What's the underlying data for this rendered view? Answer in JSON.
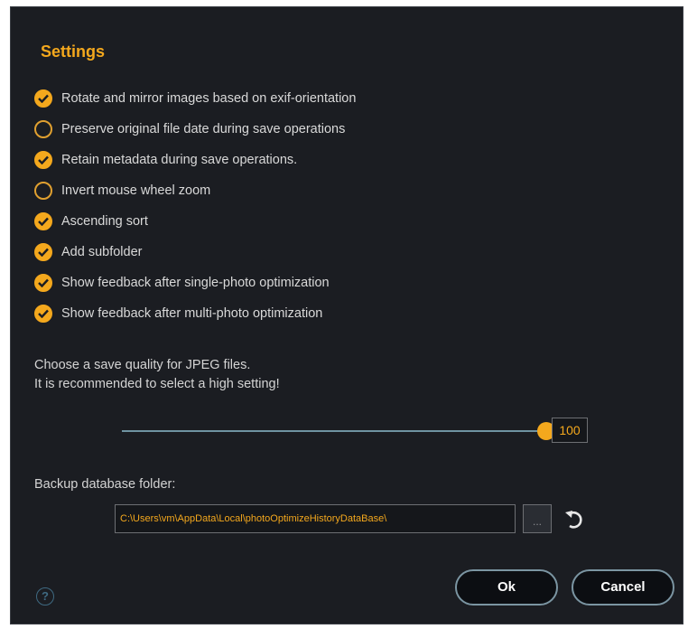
{
  "dialog": {
    "title": "Settings"
  },
  "options": [
    {
      "label": "Rotate and mirror images based on exif-orientation",
      "checked": true
    },
    {
      "label": "Preserve original file date during save operations",
      "checked": false
    },
    {
      "label": "Retain metadata during save operations.",
      "checked": true
    },
    {
      "label": "Invert mouse wheel zoom",
      "checked": false
    },
    {
      "label": "Ascending sort",
      "checked": true
    },
    {
      "label": "Add subfolder",
      "checked": true
    },
    {
      "label": "Show feedback after single-photo optimization",
      "checked": true
    },
    {
      "label": "Show feedback after multi-photo optimization",
      "checked": true
    }
  ],
  "quality": {
    "line1": "Choose a save quality for JPEG files.",
    "line2": "It is recommended to select a high setting!",
    "value": "100",
    "fraction": 1.0
  },
  "backup": {
    "label": "Backup database folder:",
    "path": "C:\\Users\\vm\\AppData\\Local\\photoOptimizeHistoryDataBase\\",
    "browse_label": "..."
  },
  "help": {
    "label": "?"
  },
  "buttons": {
    "ok": "Ok",
    "cancel": "Cancel"
  },
  "colors": {
    "accent": "#f4a81d",
    "background": "#1b1d22",
    "button_border": "#7b95a2"
  },
  "icons": {
    "check": "checkmark-icon",
    "reset": "undo-icon",
    "help": "question-circle-icon"
  }
}
